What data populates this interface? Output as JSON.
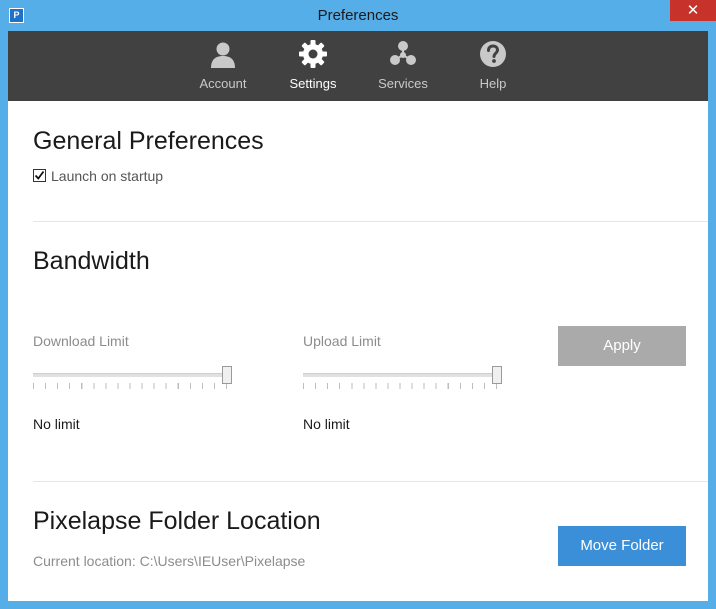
{
  "window": {
    "title": "Preferences",
    "app_icon": "P",
    "close_glyph": "✕",
    "accent_color": "#56aee8"
  },
  "toolbar": {
    "items": [
      {
        "label": "Account",
        "icon": "user-icon",
        "active": false
      },
      {
        "label": "Settings",
        "icon": "gear-icon",
        "active": true
      },
      {
        "label": "Services",
        "icon": "services-icon",
        "active": false
      },
      {
        "label": "Help",
        "icon": "help-icon",
        "active": false
      }
    ],
    "background": "#414141"
  },
  "general": {
    "title": "General Preferences",
    "launch_on_startup": {
      "label": "Launch on startup",
      "checked": true
    }
  },
  "bandwidth": {
    "title": "Bandwidth",
    "download": {
      "label": "Download Limit",
      "value": "No limit",
      "slider_fraction": 1.0
    },
    "upload": {
      "label": "Upload Limit",
      "value": "No limit",
      "slider_fraction": 1.0
    },
    "apply_label": "Apply",
    "apply_color": "#aaaaaa"
  },
  "folder": {
    "title": "Pixelapse Folder Location",
    "current_location": "Current location: C:\\Users\\IEUser\\Pixelapse",
    "move_label": "Move Folder",
    "move_color": "#3b8fd9"
  }
}
